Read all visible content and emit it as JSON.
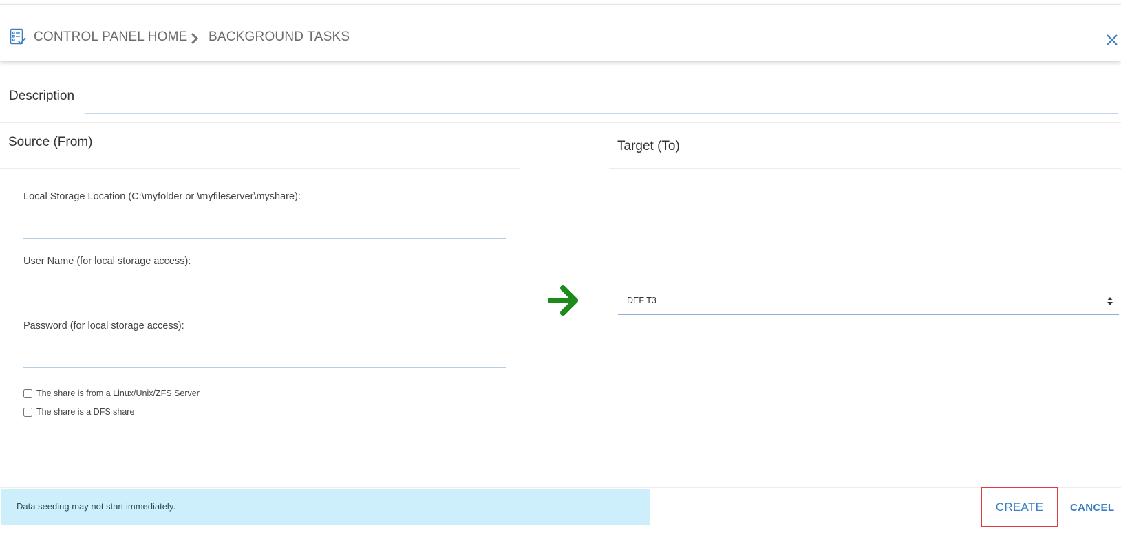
{
  "header": {
    "breadcrumb_home": "CONTROL PANEL HOME",
    "breadcrumb_current": "BACKGROUND TASKS",
    "icons": {
      "app": "checklist-icon",
      "separator": "chevron-right-icon",
      "close": "close-icon"
    }
  },
  "description": {
    "label": "Description",
    "value": ""
  },
  "source": {
    "title": "Source (From)",
    "local_storage_label": "Local Storage Location (C:\\myfolder or \\myfileserver\\myshare):",
    "local_storage_value": "",
    "username_label": "User Name (for local storage access):",
    "username_value": "",
    "password_label": "Password (for local storage access):",
    "password_value": "",
    "checkbox_linux_label": "The share is from a Linux/Unix/ZFS Server",
    "checkbox_linux_checked": false,
    "checkbox_dfs_label": "The share is a DFS share",
    "checkbox_dfs_checked": false
  },
  "arrow": {
    "icon": "arrow-right-icon",
    "color": "#1e8a1e"
  },
  "target": {
    "title": "Target (To)",
    "selected": "DEF T3"
  },
  "footer": {
    "notice": "Data seeding may not start immediately.",
    "create_label": "CREATE",
    "cancel_label": "CANCEL"
  },
  "colors": {
    "accent": "#3a7fc1",
    "notice_bg": "#cdeefb",
    "highlight_border": "#e0393e"
  }
}
